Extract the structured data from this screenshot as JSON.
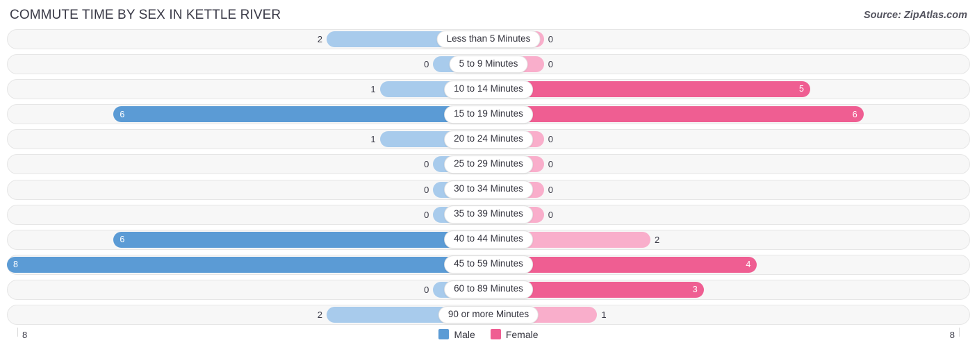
{
  "header": {
    "title": "COMMUTE TIME BY SEX IN KETTLE RIVER",
    "source": "Source: ZipAtlas.com"
  },
  "legend": {
    "male_label": "Male",
    "female_label": "Female",
    "male_color": "#5B9BD5",
    "female_color": "#EF5E92"
  },
  "axis": {
    "left_tick": "8",
    "right_tick": "8"
  },
  "colors": {
    "male_strong": "#5B9BD5",
    "male_light": "#A8CBEC",
    "female_strong": "#EF5E92",
    "female_light": "#F9AECB",
    "track_bg": "#f7f7f7",
    "track_border": "#e6e6e6"
  },
  "chart_data": {
    "type": "bar",
    "subtype": "diverging-bidirectional",
    "title": "COMMUTE TIME BY SEX IN KETTLE RIVER",
    "xlabel": "",
    "ylabel": "",
    "xlim": [
      8,
      8
    ],
    "axis_max": 8,
    "grid": false,
    "legend_position": "bottom-center",
    "categories": [
      "Less than 5 Minutes",
      "5 to 9 Minutes",
      "10 to 14 Minutes",
      "15 to 19 Minutes",
      "20 to 24 Minutes",
      "25 to 29 Minutes",
      "30 to 34 Minutes",
      "35 to 39 Minutes",
      "40 to 44 Minutes",
      "45 to 59 Minutes",
      "60 to 89 Minutes",
      "90 or more Minutes"
    ],
    "series": [
      {
        "name": "Male",
        "color": "#5B9BD5",
        "values": [
          2,
          0,
          1,
          6,
          1,
          0,
          0,
          0,
          6,
          8,
          0,
          2
        ]
      },
      {
        "name": "Female",
        "color": "#EF5E92",
        "values": [
          0,
          0,
          5,
          6,
          0,
          0,
          0,
          0,
          2,
          4,
          3,
          1
        ]
      }
    ]
  },
  "rows": [
    {
      "category": "Less than 5 Minutes",
      "male": "2",
      "female": "0"
    },
    {
      "category": "5 to 9 Minutes",
      "male": "0",
      "female": "0"
    },
    {
      "category": "10 to 14 Minutes",
      "male": "1",
      "female": "5"
    },
    {
      "category": "15 to 19 Minutes",
      "male": "6",
      "female": "6"
    },
    {
      "category": "20 to 24 Minutes",
      "male": "1",
      "female": "0"
    },
    {
      "category": "25 to 29 Minutes",
      "male": "0",
      "female": "0"
    },
    {
      "category": "30 to 34 Minutes",
      "male": "0",
      "female": "0"
    },
    {
      "category": "35 to 39 Minutes",
      "male": "0",
      "female": "0"
    },
    {
      "category": "40 to 44 Minutes",
      "male": "6",
      "female": "2"
    },
    {
      "category": "45 to 59 Minutes",
      "male": "8",
      "female": "4"
    },
    {
      "category": "60 to 89 Minutes",
      "male": "0",
      "female": "3"
    },
    {
      "category": "90 or more Minutes",
      "male": "2",
      "female": "1"
    }
  ]
}
